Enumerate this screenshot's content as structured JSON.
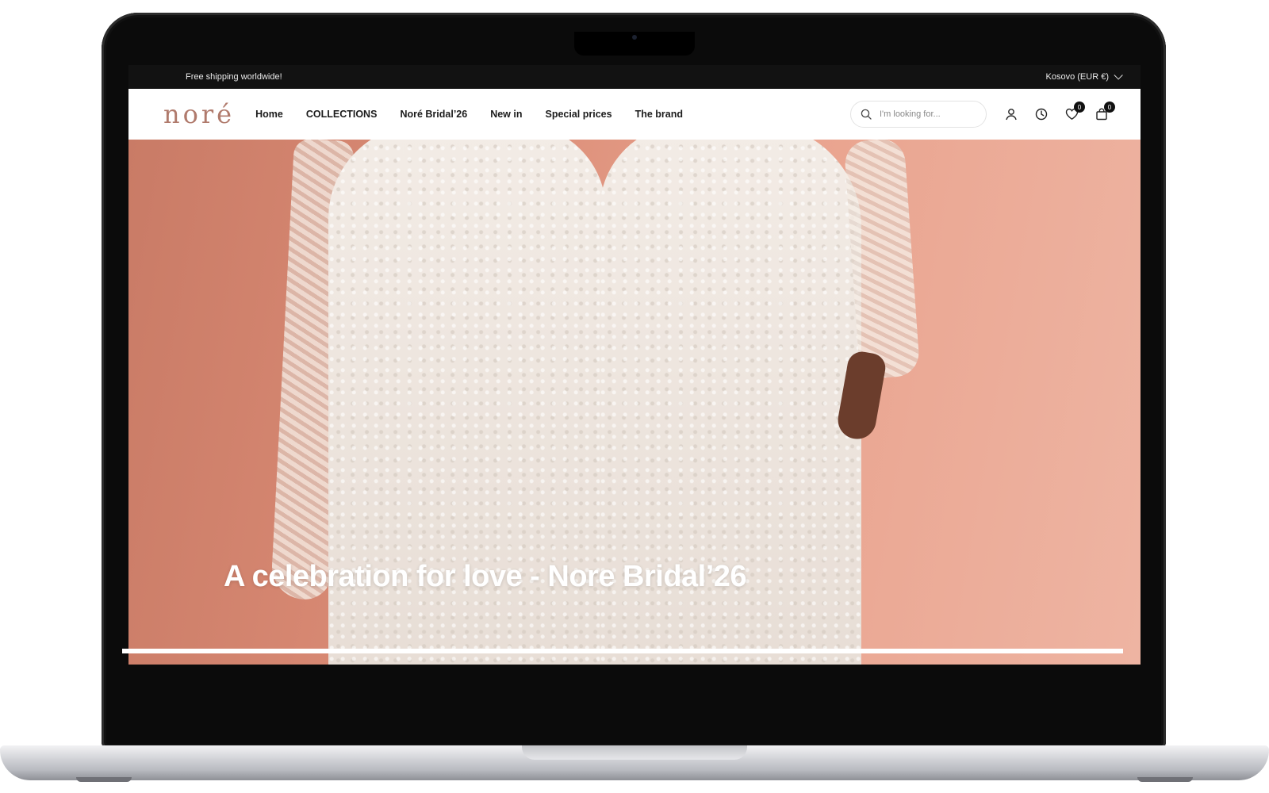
{
  "announcement": {
    "text": "Free shipping worldwide!"
  },
  "region": {
    "label": "Kosovo (EUR €)"
  },
  "brand": {
    "logo_text": "noré"
  },
  "menu": {
    "items": [
      {
        "label": "Home"
      },
      {
        "label": "COLLECTIONS"
      },
      {
        "label": "Noré Bridal’26"
      },
      {
        "label": "New in"
      },
      {
        "label": "Special prices"
      },
      {
        "label": "The brand"
      }
    ]
  },
  "search": {
    "placeholder": "I'm looking for..."
  },
  "header_icons": {
    "account": "user-icon",
    "recent": "clock-icon",
    "wishlist": "heart-icon",
    "wishlist_count": "0",
    "cart": "bag-icon",
    "cart_count": "0"
  },
  "hero": {
    "title": "A celebration for love - Nore Bridal’26"
  },
  "colors": {
    "accent": "#b07a6c",
    "hero_bg": "#d98a74",
    "topbar": "#121212"
  }
}
